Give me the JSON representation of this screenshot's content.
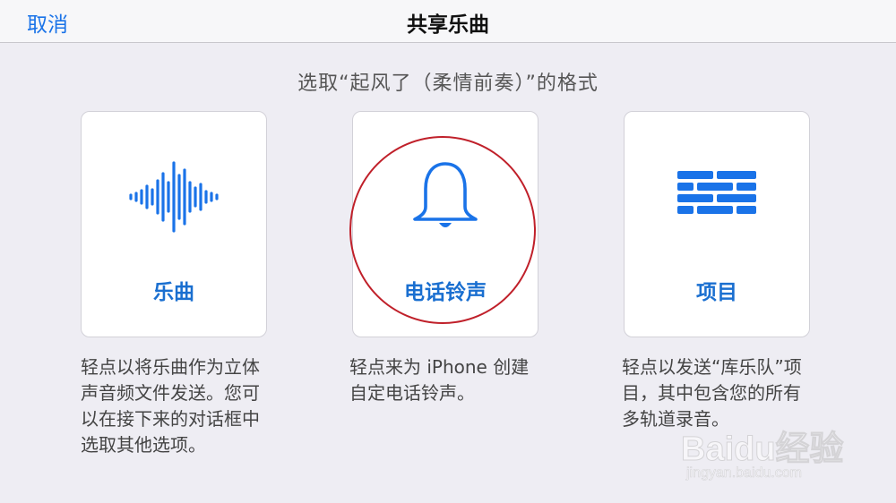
{
  "navbar": {
    "cancel_label": "取消",
    "title": "共享乐曲"
  },
  "prompt": "选取“起风了（柔情前奏）”的格式",
  "options": [
    {
      "icon": "waveform-icon",
      "label": "乐曲",
      "description": "轻点以将乐曲作为立体声音频文件发送。您可以在接下来的对话框中选取其他选项。"
    },
    {
      "icon": "bell-icon",
      "label": "电话铃声",
      "description": "轻点来为 iPhone 创建自定电话铃声。"
    },
    {
      "icon": "bricks-icon",
      "label": "项目",
      "description": "轻点以发送“库乐队”项目，其中包含您的所有多轨道录音。"
    }
  ],
  "watermark": {
    "logo": "Baidu经验",
    "url": "jingyan.baidu.com"
  },
  "colors": {
    "accent": "#1a6fd0",
    "highlight": "#c0202a",
    "background": "#eeedf3"
  }
}
